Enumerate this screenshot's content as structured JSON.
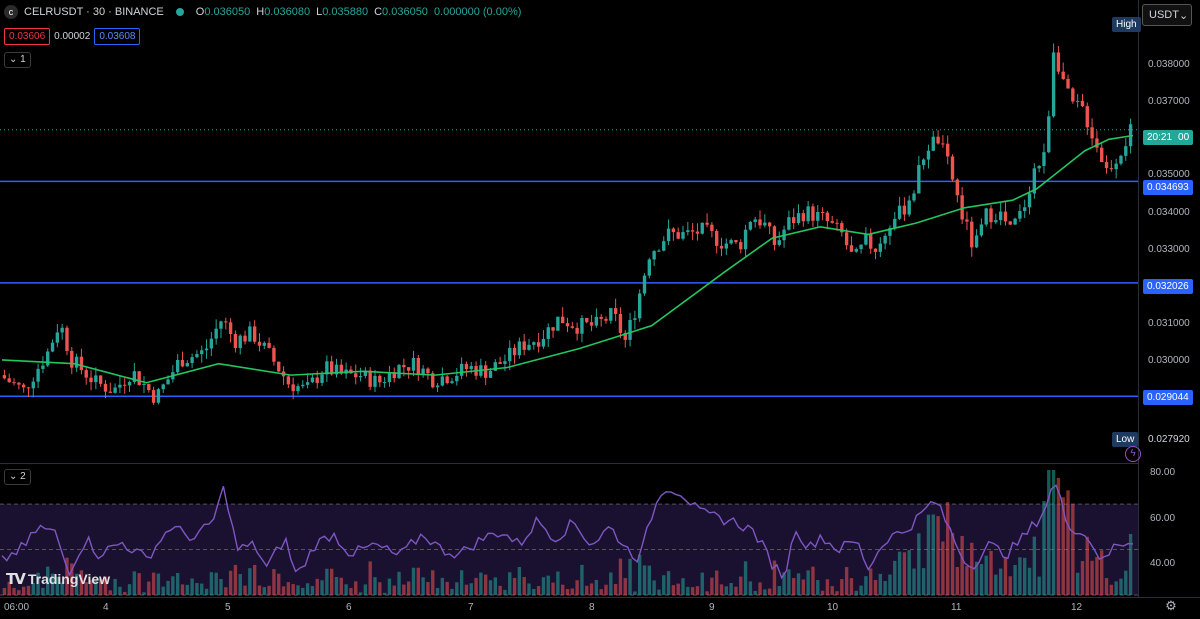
{
  "header": {
    "symbol_line": "CELRUSDT · 30 · BINANCE",
    "logo_letter": "c",
    "ohlc": [
      {
        "key": "O",
        "value": "0.036050"
      },
      {
        "key": "H",
        "value": "0.036080"
      },
      {
        "key": "L",
        "value": "0.035880"
      },
      {
        "key": "C",
        "value": "0.036050"
      },
      {
        "key": "",
        "value": "0.000000 (0.00%)"
      }
    ],
    "bid": "0.03606",
    "spread": "0.00002",
    "ask": "0.03608",
    "pane1_toggle": "⌄ 1",
    "pane2_toggle": "⌄ 2",
    "currency": "USDT",
    "currency_icon": "chevron-down-icon"
  },
  "price_axis": {
    "ticks": [
      "0.038000",
      "0.037000",
      "0.035000",
      "0.034000",
      "0.033000",
      "0.031000",
      "0.030000"
    ],
    "high_label": "High",
    "low_label": "Low",
    "low_value": "0.027920",
    "countdown": "20:21",
    "countdown_suffix": "00",
    "levels": [
      "0.034693",
      "0.032026",
      "0.029044"
    ]
  },
  "rsi_axis": {
    "ticks": [
      "80.00",
      "60.00",
      "40.00"
    ]
  },
  "time_axis": {
    "labels": [
      "06:00",
      "4",
      "5",
      "6",
      "7",
      "8",
      "9",
      "10",
      "11",
      "12"
    ]
  },
  "brand": "TradingView",
  "colors": {
    "up": "#26a69a",
    "down": "#ef5350",
    "ma": "#22c55e",
    "level": "#2962ff",
    "rsi": "#7e57c2",
    "countdown": "#26a69a"
  },
  "chart_data": {
    "type": "candlestick",
    "symbol": "CELRUSDT",
    "interval": "30",
    "exchange": "BINANCE",
    "ylim": [
      0.0275,
      0.0392
    ],
    "x_labels": [
      "06:00",
      "4",
      "5",
      "6",
      "7",
      "8",
      "9",
      "10",
      "11",
      "12"
    ],
    "price_path": [
      [
        0.0,
        0.0296
      ],
      [
        2.0,
        0.0292
      ],
      [
        4.0,
        0.0302
      ],
      [
        5.0,
        0.031
      ],
      [
        6.0,
        0.03
      ],
      [
        8.0,
        0.0294
      ],
      [
        9.5,
        0.0292
      ],
      [
        11.0,
        0.0297
      ],
      [
        13.0,
        0.029
      ],
      [
        15.0,
        0.03
      ],
      [
        17.0,
        0.0302
      ],
      [
        18.5,
        0.0311
      ],
      [
        19.5,
        0.0305
      ],
      [
        21.0,
        0.0307
      ],
      [
        22.5,
        0.0301
      ],
      [
        24.0,
        0.0294
      ],
      [
        25.5,
        0.0292
      ],
      [
        27.0,
        0.0298
      ],
      [
        28.5,
        0.0296
      ],
      [
        30.0,
        0.0296
      ],
      [
        31.5,
        0.0294
      ],
      [
        33.0,
        0.0298
      ],
      [
        34.5,
        0.0299
      ],
      [
        36.0,
        0.0295
      ],
      [
        37.5,
        0.0296
      ],
      [
        39.0,
        0.0298
      ],
      [
        40.5,
        0.0297
      ],
      [
        42.0,
        0.03
      ],
      [
        43.5,
        0.0304
      ],
      [
        45.0,
        0.0306
      ],
      [
        46.5,
        0.0311
      ],
      [
        48.0,
        0.0309
      ],
      [
        49.5,
        0.0309
      ],
      [
        51.0,
        0.0312
      ],
      [
        52.0,
        0.0305
      ],
      [
        53.0,
        0.0315
      ],
      [
        54.0,
        0.0328
      ],
      [
        55.5,
        0.0333
      ],
      [
        57.0,
        0.0333
      ],
      [
        58.5,
        0.0334
      ],
      [
        60.0,
        0.0331
      ],
      [
        61.5,
        0.033
      ],
      [
        62.5,
        0.0338
      ],
      [
        63.5,
        0.0336
      ],
      [
        64.5,
        0.033
      ],
      [
        65.5,
        0.0336
      ],
      [
        67.0,
        0.0339
      ],
      [
        68.5,
        0.0337
      ],
      [
        70.0,
        0.0333
      ],
      [
        71.0,
        0.0326
      ],
      [
        72.0,
        0.0331
      ],
      [
        73.0,
        0.0329
      ],
      [
        74.0,
        0.0336
      ],
      [
        75.0,
        0.0339
      ],
      [
        76.0,
        0.0345
      ],
      [
        77.0,
        0.0356
      ],
      [
        78.0,
        0.0358
      ],
      [
        79.0,
        0.035
      ],
      [
        80.0,
        0.0338
      ],
      [
        81.0,
        0.0329
      ],
      [
        82.0,
        0.0338
      ],
      [
        83.0,
        0.0339
      ],
      [
        84.0,
        0.0334
      ],
      [
        85.0,
        0.0339
      ],
      [
        86.0,
        0.035
      ],
      [
        87.0,
        0.0354
      ],
      [
        87.5,
        0.0383
      ],
      [
        88.0,
        0.0378
      ],
      [
        89.0,
        0.0367
      ],
      [
        90.0,
        0.0366
      ],
      [
        91.0,
        0.0358
      ],
      [
        92.0,
        0.035
      ],
      [
        93.0,
        0.0354
      ],
      [
        94.0,
        0.036
      ]
    ],
    "ma_path": [
      [
        0.0,
        0.03
      ],
      [
        6.0,
        0.0299
      ],
      [
        12.0,
        0.0294
      ],
      [
        18.0,
        0.0299
      ],
      [
        24.0,
        0.0296
      ],
      [
        30.0,
        0.0297
      ],
      [
        36.0,
        0.0296
      ],
      [
        42.0,
        0.0298
      ],
      [
        48.0,
        0.0303
      ],
      [
        54.0,
        0.0309
      ],
      [
        60.0,
        0.0323
      ],
      [
        64.0,
        0.0332
      ],
      [
        68.0,
        0.0335
      ],
      [
        72.0,
        0.0333
      ],
      [
        76.0,
        0.0336
      ],
      [
        80.0,
        0.034
      ],
      [
        84.0,
        0.0342
      ],
      [
        86.0,
        0.0345
      ],
      [
        88.0,
        0.035
      ],
      [
        90.0,
        0.0355
      ],
      [
        92.0,
        0.0358
      ],
      [
        94.0,
        0.0359
      ]
    ],
    "horizontal_levels": [
      0.034693,
      0.032026,
      0.029044
    ],
    "last_price": 0.03605,
    "rsi": {
      "ylim": [
        30,
        85
      ],
      "bands": [
        70,
        50,
        30
      ],
      "path": [
        [
          0.0,
          45
        ],
        [
          2.0,
          52
        ],
        [
          3.0,
          60
        ],
        [
          4.5,
          57
        ],
        [
          5.5,
          40
        ],
        [
          7.0,
          55
        ],
        [
          8.0,
          48
        ],
        [
          10.0,
          53
        ],
        [
          12.0,
          46
        ],
        [
          14.0,
          60
        ],
        [
          16.0,
          55
        ],
        [
          17.5,
          62
        ],
        [
          18.5,
          78
        ],
        [
          19.5,
          50
        ],
        [
          21.0,
          52
        ],
        [
          22.0,
          42
        ],
        [
          23.5,
          55
        ],
        [
          24.5,
          38
        ],
        [
          26.0,
          52
        ],
        [
          27.5,
          57
        ],
        [
          29.0,
          48
        ],
        [
          31.0,
          52
        ],
        [
          33.0,
          47
        ],
        [
          35.0,
          57
        ],
        [
          36.5,
          50
        ],
        [
          38.0,
          48
        ],
        [
          40.0,
          55
        ],
        [
          41.5,
          58
        ],
        [
          43.0,
          52
        ],
        [
          44.5,
          63
        ],
        [
          46.0,
          55
        ],
        [
          47.5,
          62
        ],
        [
          49.0,
          52
        ],
        [
          50.5,
          60
        ],
        [
          52.0,
          50
        ],
        [
          53.0,
          46
        ],
        [
          54.0,
          65
        ],
        [
          55.0,
          78
        ],
        [
          56.5,
          75
        ],
        [
          58.0,
          66
        ],
        [
          59.5,
          64
        ],
        [
          61.0,
          62
        ],
        [
          62.5,
          58
        ],
        [
          64.0,
          44
        ],
        [
          65.0,
          38
        ],
        [
          66.0,
          60
        ],
        [
          67.0,
          50
        ],
        [
          68.0,
          56
        ],
        [
          69.5,
          50
        ],
        [
          71.0,
          54
        ],
        [
          72.0,
          42
        ],
        [
          73.5,
          55
        ],
        [
          75.0,
          58
        ],
        [
          76.5,
          66
        ],
        [
          77.5,
          72
        ],
        [
          78.5,
          62
        ],
        [
          79.5,
          50
        ],
        [
          80.5,
          42
        ],
        [
          82.0,
          52
        ],
        [
          83.5,
          48
        ],
        [
          85.0,
          56
        ],
        [
          86.5,
          66
        ],
        [
          87.5,
          80
        ],
        [
          88.5,
          62
        ],
        [
          89.5,
          58
        ],
        [
          90.5,
          54
        ],
        [
          91.5,
          44
        ],
        [
          92.5,
          52
        ],
        [
          94.0,
          54
        ]
      ]
    }
  }
}
